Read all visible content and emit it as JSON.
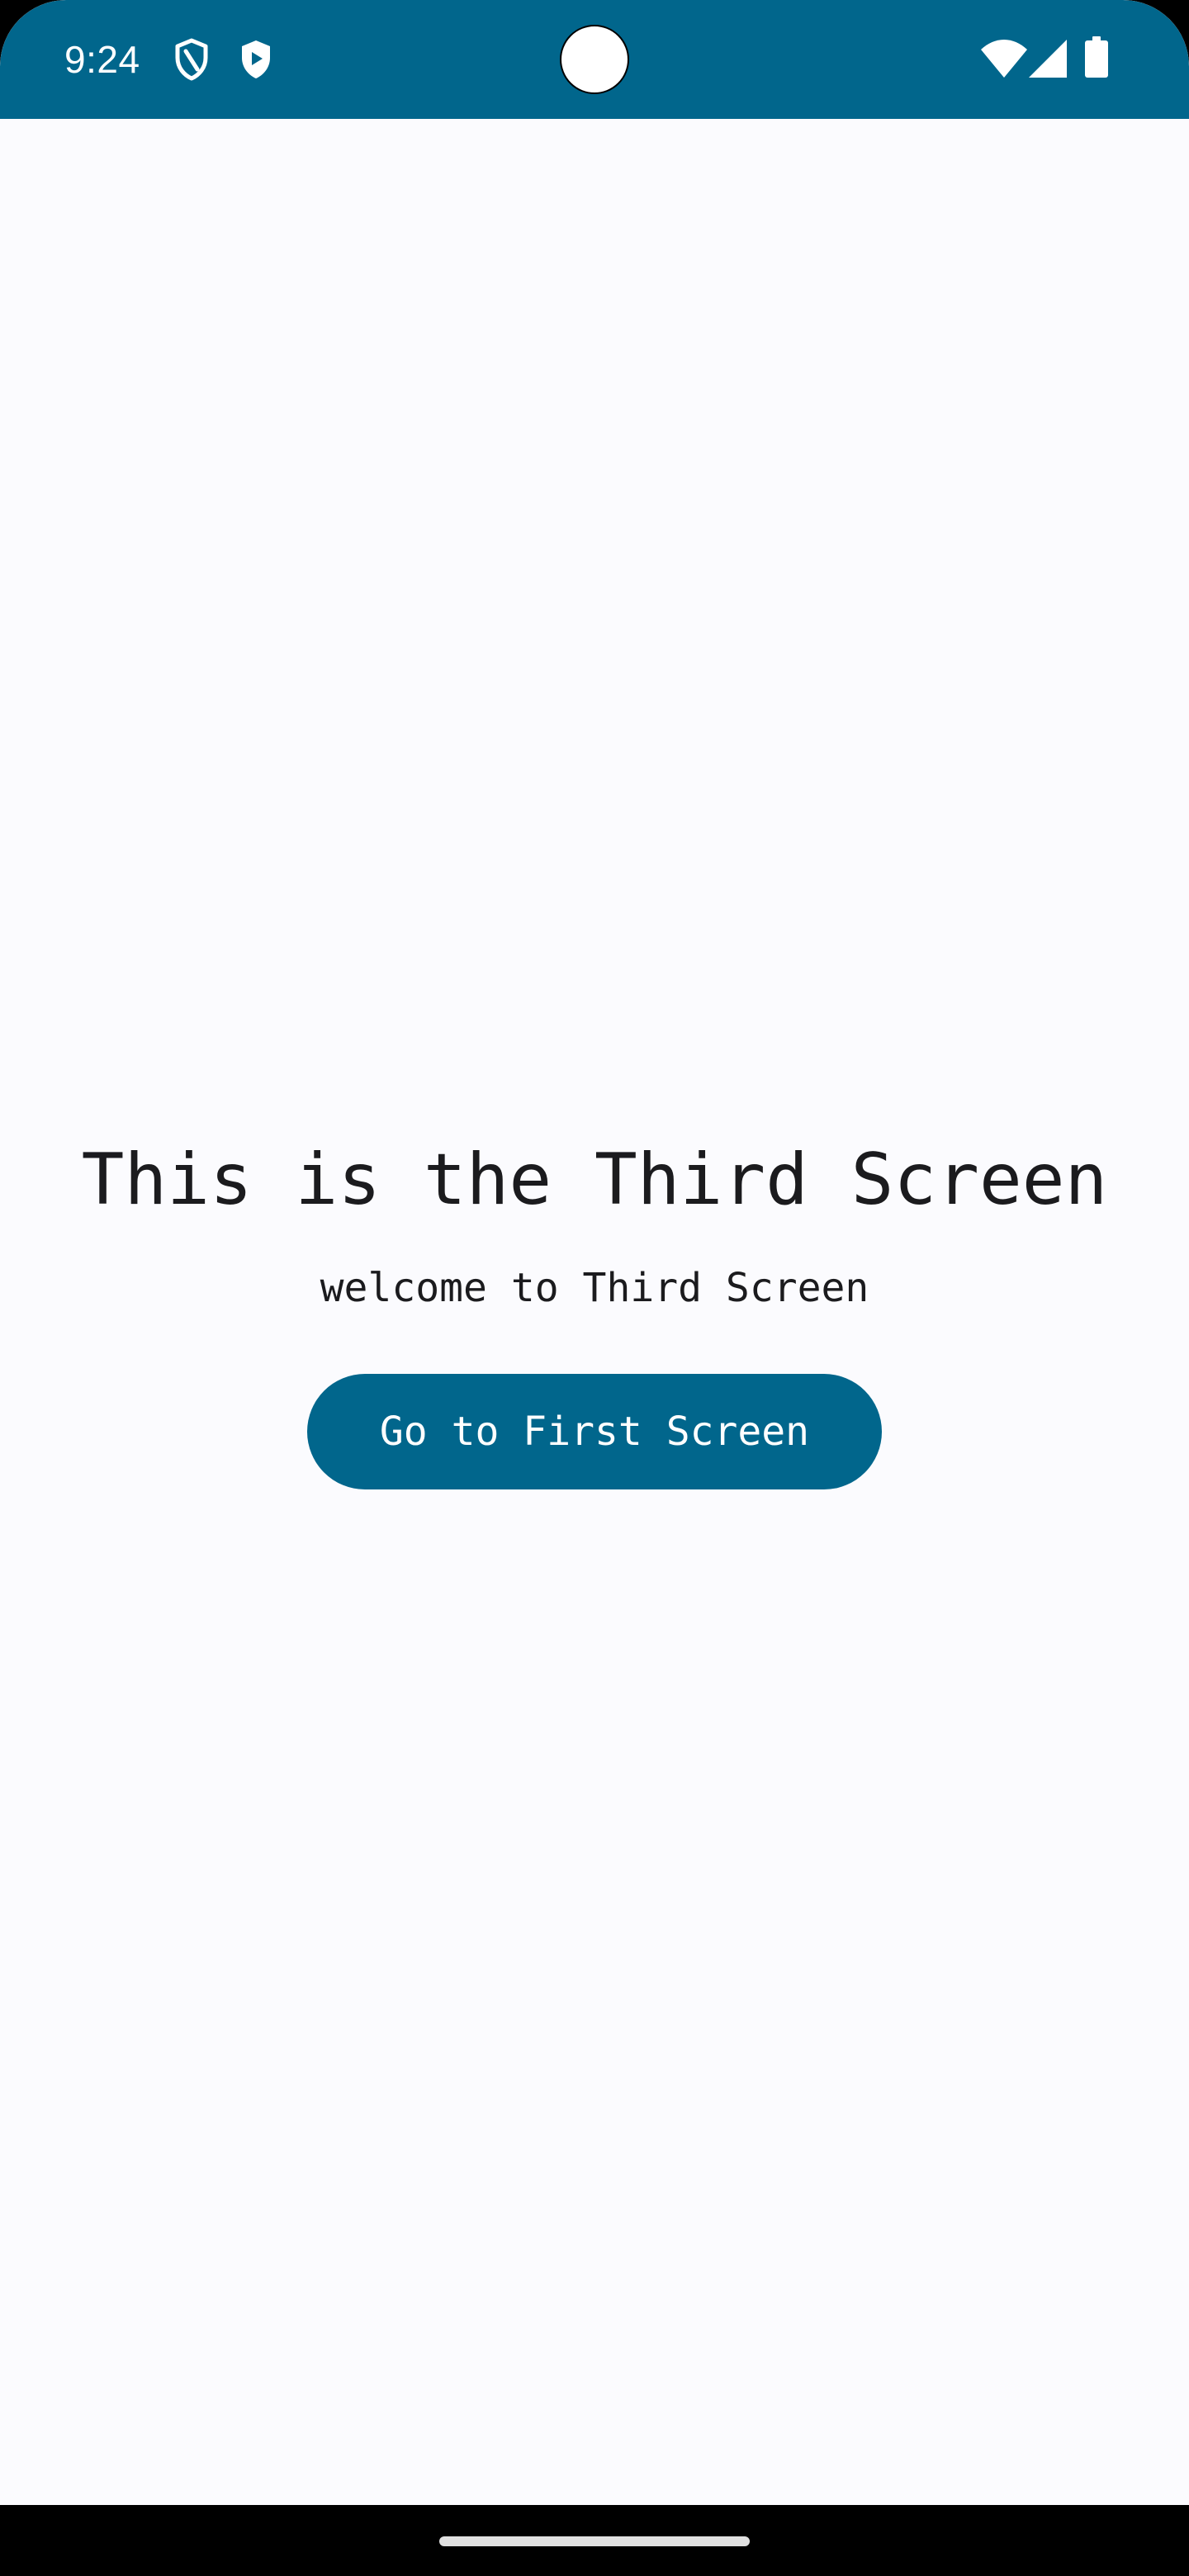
{
  "status_bar": {
    "time": "9:24",
    "background_color": "#01668c",
    "left_icons": [
      "shield-outline-icon",
      "shield-play-icon"
    ],
    "right_icons": [
      "wifi-icon",
      "cellular-signal-icon",
      "battery-icon"
    ]
  },
  "screen": {
    "title": "This is the Third Screen",
    "subtitle": "welcome to Third Screen",
    "primary_button_label": "Go to First Screen",
    "background_color": "#fbfbfe",
    "accent_color": "#01668c"
  },
  "navigation_bar": {
    "handle": "home-indicator"
  }
}
